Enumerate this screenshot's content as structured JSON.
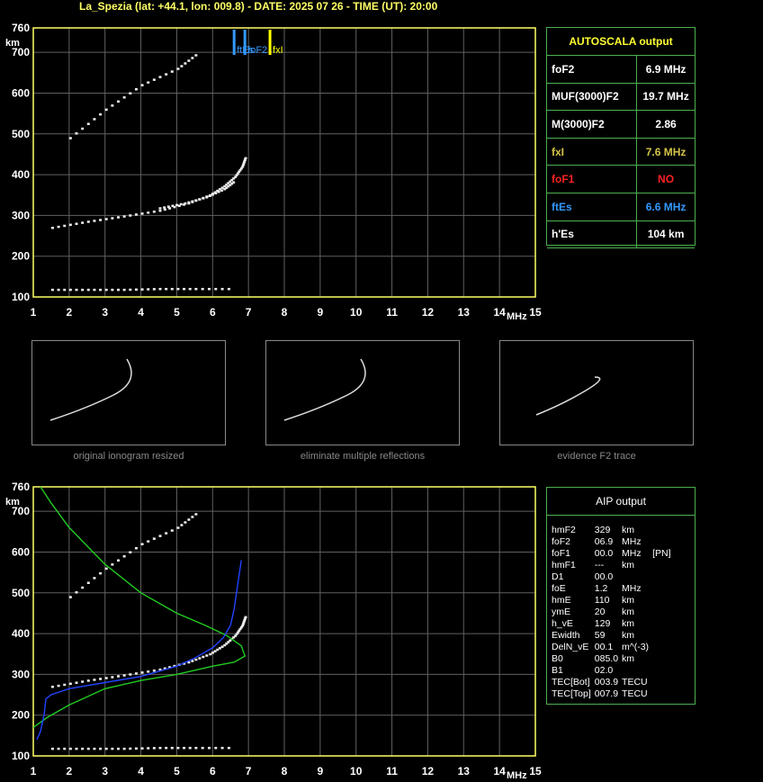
{
  "header": "La_Spezia (lat: +44.1, lon: 009.8) - DATE: 2025 07 26 - TIME (UT): 20:00",
  "colors": {
    "axis": "#ffff66",
    "grid": "#606060",
    "green": "#22cc22",
    "blue": "#2244ff",
    "fxI": "#ffff00",
    "ftEs": "#3399ff"
  },
  "autoscala": {
    "title": "AUTOSCALA output",
    "rows": [
      {
        "label": "foF2",
        "value": "6.9 MHz",
        "color": "#ffffff"
      },
      {
        "label": "MUF(3000)F2",
        "value": "19.7 MHz",
        "color": "#ffffff"
      },
      {
        "label": "M(3000)F2",
        "value": "2.86",
        "color": "#ffffff"
      },
      {
        "label": "fxI",
        "value": "7.6 MHz",
        "color": "#d4c44a"
      },
      {
        "label": "foF1",
        "value": "NO",
        "color": "#ff2222"
      },
      {
        "label": "ftEs",
        "value": "6.6 MHz",
        "color": "#3399ff"
      },
      {
        "label": "h'Es",
        "value": "104     km",
        "color": "#ffffff"
      }
    ]
  },
  "aip": {
    "title": "AIP output",
    "rows": [
      [
        "hmF2",
        "329",
        "km",
        ""
      ],
      [
        "foF2",
        "06.9",
        "MHz",
        ""
      ],
      [
        "foF1",
        "00.0",
        "MHz",
        "[PN]"
      ],
      [
        "hmF1",
        "---",
        "km",
        ""
      ],
      [
        "D1",
        "00.0",
        "",
        ""
      ],
      [
        "foE",
        "1.2",
        "MHz",
        ""
      ],
      [
        "hmE",
        "110",
        "km",
        ""
      ],
      [
        "ymE",
        "20",
        "km",
        ""
      ],
      [
        "h_vE",
        "129",
        "km",
        ""
      ],
      [
        "Ewidth",
        "59",
        "km",
        ""
      ],
      [
        "DelN_vE",
        "00.1",
        "m^(-3)",
        ""
      ],
      [
        "B0",
        "085.0",
        "km",
        ""
      ],
      [
        "B1",
        "02.0",
        "",
        ""
      ],
      [
        "TEC[Bot]",
        "003.9",
        "TECU",
        ""
      ],
      [
        "TEC[Top]",
        "007.9",
        "TECU",
        ""
      ]
    ]
  },
  "thumb_captions": [
    "original ionogram resized",
    "eliminate multiple reflections",
    "evidence F2 trace"
  ],
  "chart_data": [
    {
      "type": "scatter",
      "title": "",
      "xlabel": "MHz",
      "ylabel": "km",
      "xlim": [
        1,
        15
      ],
      "ylim": [
        100,
        760
      ],
      "xticks": [
        1,
        2,
        3,
        4,
        5,
        6,
        7,
        8,
        9,
        10,
        11,
        12,
        13,
        14,
        15
      ],
      "yticks": [
        100,
        200,
        300,
        400,
        500,
        600,
        700,
        760
      ],
      "grid": true,
      "markers": [
        {
          "label": "ftEs",
          "x": 6.6,
          "color": "#3399ff"
        },
        {
          "label": "foF2",
          "x": 6.9,
          "color": "#3399ff"
        },
        {
          "label": "fxI",
          "x": 7.6,
          "color": "#ffff00"
        }
      ],
      "traces": {
        "F2_o": [
          [
            1.5,
            270
          ],
          [
            2.5,
            285
          ],
          [
            3.5,
            298
          ],
          [
            4.5,
            312
          ],
          [
            5.3,
            330
          ],
          [
            5.9,
            350
          ],
          [
            6.3,
            372
          ],
          [
            6.6,
            395
          ],
          [
            6.8,
            420
          ],
          [
            6.9,
            445
          ]
        ],
        "F2_x": [
          [
            4.5,
            318
          ],
          [
            5.2,
            330
          ],
          [
            5.8,
            345
          ],
          [
            6.3,
            365
          ],
          [
            6.6,
            385
          ]
        ],
        "F2_2hop": [
          [
            2.0,
            490
          ],
          [
            3.0,
            560
          ],
          [
            4.0,
            620
          ],
          [
            5.0,
            660
          ],
          [
            5.6,
            700
          ]
        ],
        "Es": [
          [
            1.5,
            118
          ],
          [
            2.5,
            118
          ],
          [
            3.5,
            118
          ],
          [
            4.5,
            120
          ],
          [
            5.5,
            120
          ],
          [
            6.6,
            120
          ]
        ]
      }
    },
    {
      "type": "line",
      "title": "",
      "xlabel": "MHz",
      "ylabel": "km",
      "xlim": [
        1,
        15
      ],
      "ylim": [
        100,
        760
      ],
      "grid": true,
      "series": [
        {
          "color": "#22cc22",
          "points": [
            [
              1.2,
              760
            ],
            [
              1.5,
              720
            ],
            [
              2.0,
              660
            ],
            [
              3.0,
              570
            ],
            [
              4.0,
              500
            ],
            [
              5.0,
              450
            ],
            [
              5.8,
              420
            ],
            [
              6.4,
              395
            ],
            [
              6.8,
              370
            ],
            [
              6.9,
              345
            ],
            [
              6.6,
              330
            ],
            [
              6.0,
              320
            ],
            [
              5.0,
              300
            ],
            [
              4.0,
              285
            ],
            [
              3.0,
              265
            ],
            [
              2.0,
              225
            ],
            [
              1.4,
              195
            ],
            [
              1.0,
              170
            ]
          ]
        },
        {
          "color": "#2244ff",
          "points": [
            [
              1.1,
              140
            ],
            [
              1.2,
              160
            ],
            [
              1.3,
              200
            ],
            [
              1.35,
              240
            ],
            [
              1.5,
              250
            ],
            [
              2.0,
              265
            ],
            [
              3.0,
              280
            ],
            [
              4.0,
              295
            ],
            [
              5.0,
              320
            ],
            [
              5.5,
              340
            ],
            [
              6.0,
              365
            ],
            [
              6.3,
              390
            ],
            [
              6.5,
              420
            ],
            [
              6.6,
              460
            ],
            [
              6.7,
              520
            ],
            [
              6.8,
              580
            ]
          ]
        }
      ],
      "traces": {
        "F2_o": [
          [
            1.5,
            270
          ],
          [
            2.5,
            285
          ],
          [
            3.5,
            298
          ],
          [
            4.5,
            312
          ],
          [
            5.3,
            330
          ],
          [
            5.9,
            350
          ],
          [
            6.3,
            372
          ],
          [
            6.6,
            395
          ],
          [
            6.8,
            420
          ],
          [
            6.9,
            445
          ]
        ],
        "F2_2hop": [
          [
            2.0,
            490
          ],
          [
            3.0,
            560
          ],
          [
            4.0,
            620
          ],
          [
            5.0,
            660
          ],
          [
            5.6,
            700
          ]
        ],
        "Es": [
          [
            1.5,
            118
          ],
          [
            2.5,
            118
          ],
          [
            3.5,
            118
          ],
          [
            4.5,
            120
          ],
          [
            5.5,
            120
          ],
          [
            6.6,
            120
          ]
        ]
      }
    }
  ]
}
